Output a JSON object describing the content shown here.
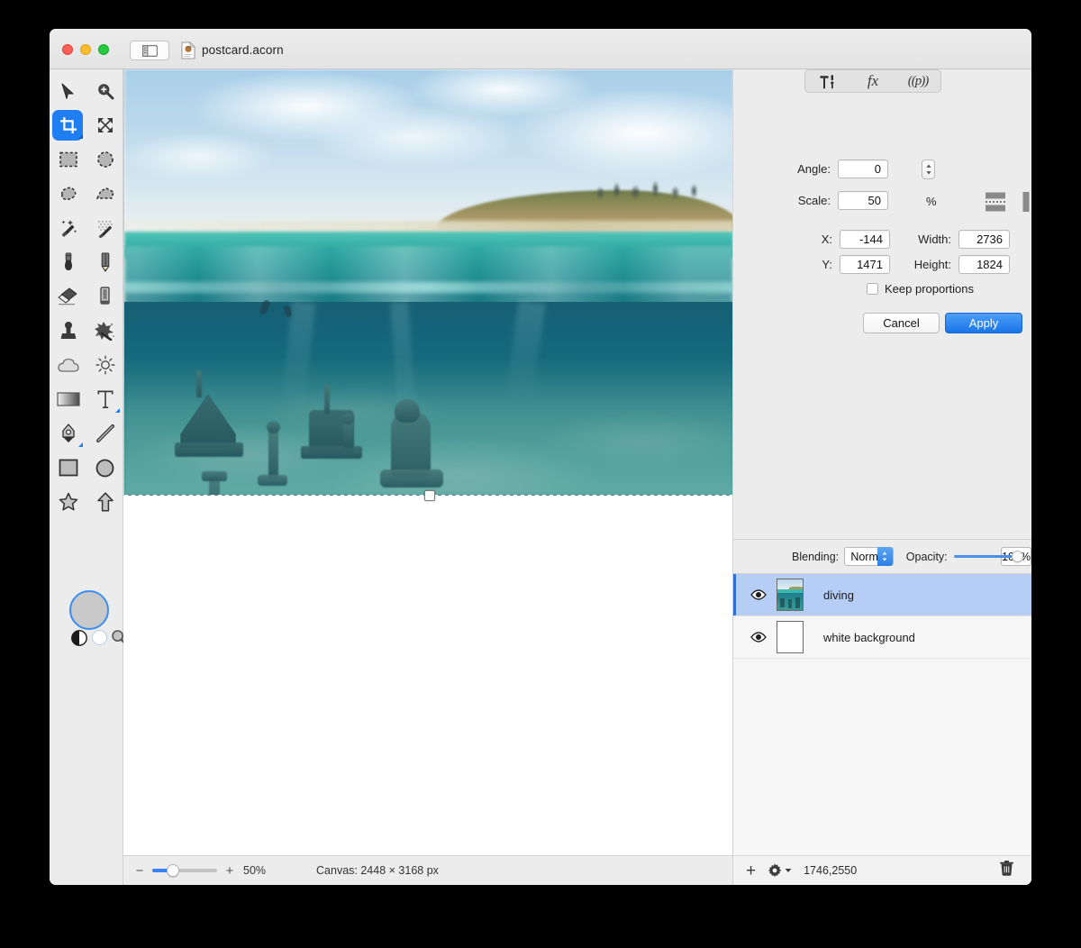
{
  "window": {
    "title": "postcard.acorn",
    "traffic_lights": [
      "close",
      "minimize",
      "maximize"
    ],
    "sidebar_toggle_icon": "sidebar-toggle-icon",
    "document_icon": "acorn-document-icon"
  },
  "tools": {
    "items": [
      {
        "name": "move-tool",
        "icon": "arrow-cursor-icon",
        "active": false
      },
      {
        "name": "zoom-tool",
        "icon": "magnifier-plus-icon",
        "active": false
      },
      {
        "name": "crop-tool",
        "icon": "crop-icon",
        "active": true
      },
      {
        "name": "transform-tool",
        "icon": "four-arrows-icon",
        "active": false
      },
      {
        "name": "rectangle-select-tool",
        "icon": "marquee-rect-icon",
        "active": false
      },
      {
        "name": "ellipse-select-tool",
        "icon": "marquee-ellipse-icon",
        "active": false
      },
      {
        "name": "lasso-tool",
        "icon": "lasso-icon",
        "active": false
      },
      {
        "name": "polygon-lasso-tool",
        "icon": "polygon-lasso-icon",
        "active": false
      },
      {
        "name": "magic-wand-tool",
        "icon": "magic-wand-icon",
        "active": false
      },
      {
        "name": "instant-alpha-tool",
        "icon": "magic-wand-dots-icon",
        "active": false
      },
      {
        "name": "paint-brush-tool",
        "icon": "paintbrush-icon",
        "active": false
      },
      {
        "name": "pencil-tool",
        "icon": "pencil-icon",
        "active": false
      },
      {
        "name": "eraser-tool",
        "icon": "eraser-icon",
        "active": false
      },
      {
        "name": "marker-tool",
        "icon": "marker-icon",
        "active": false
      },
      {
        "name": "clone-stamp-tool",
        "icon": "clone-stamp-icon",
        "active": false
      },
      {
        "name": "smudge-tool",
        "icon": "smudge-splatter-icon",
        "active": false
      },
      {
        "name": "blur-tool",
        "icon": "cloud-icon",
        "active": false
      },
      {
        "name": "dodge-tool",
        "icon": "sun-icon",
        "active": false
      },
      {
        "name": "gradient-tool",
        "icon": "gradient-icon",
        "active": false
      },
      {
        "name": "text-tool",
        "icon": "text-t-icon",
        "active": false
      },
      {
        "name": "bezier-pen-tool",
        "icon": "pen-nib-icon",
        "active": false
      },
      {
        "name": "line-tool",
        "icon": "line-icon",
        "active": false
      },
      {
        "name": "rectangle-shape-tool",
        "icon": "rectangle-icon",
        "active": false
      },
      {
        "name": "ellipse-shape-tool",
        "icon": "circle-icon",
        "active": false
      },
      {
        "name": "star-shape-tool",
        "icon": "star-icon",
        "active": false
      },
      {
        "name": "arrow-shape-tool",
        "icon": "arrow-up-icon",
        "active": false
      }
    ],
    "foreground_color": "#c9c9c9",
    "background_color": "#ffffff",
    "swatch_toggle_icon": "black-white-swatch-icon",
    "color-picker_icon": "magnifier-picker-icon"
  },
  "inspector": {
    "toolbar": [
      {
        "name": "tools-tab",
        "icon": "hammer-tools-icon",
        "glyph": "⚒"
      },
      {
        "name": "filters-tab",
        "icon": "fx-icon",
        "glyph": "fx"
      },
      {
        "name": "presets-tab",
        "icon": "presets-icon",
        "glyph": "((p))"
      }
    ],
    "angle": {
      "label": "Angle:",
      "value": "0"
    },
    "scale": {
      "label": "Scale:",
      "value": "50",
      "unit": "%"
    },
    "x": {
      "label": "X:",
      "value": "-144"
    },
    "y": {
      "label": "Y:",
      "value": "1471"
    },
    "width": {
      "label": "Width:",
      "value": "2736"
    },
    "height": {
      "label": "Height:",
      "value": "1824"
    },
    "flip_horizontal_icon": "flip-horizontal-icon",
    "flip_vertical_icon": "flip-vertical-icon",
    "keep_proportions": {
      "label": "Keep proportions",
      "checked": false
    },
    "cancel_label": "Cancel",
    "apply_label": "Apply",
    "accent_color": "#1874e8"
  },
  "layers": {
    "blending_label": "Blending:",
    "blending_value": "Normal",
    "opacity_label": "Opacity:",
    "opacity_value": "100%",
    "opacity_percent": 100,
    "items": [
      {
        "name": "diving",
        "visible": true,
        "selected": true,
        "thumb": "photo"
      },
      {
        "name": "white background",
        "visible": true,
        "selected": false,
        "thumb": "white"
      }
    ],
    "footer": {
      "add_icon": "plus-icon",
      "gear_icon": "gear-icon",
      "coordinates": "1746,2550",
      "delete_icon": "trash-icon"
    },
    "selection_color": "#b6cdf5"
  },
  "status_bar": {
    "zoom_out_icon": "minus-icon",
    "zoom_in_icon": "plus-icon",
    "zoom_value": "50%",
    "zoom_percent": 50,
    "canvas_label": "Canvas: 2448 × 3168 px"
  }
}
